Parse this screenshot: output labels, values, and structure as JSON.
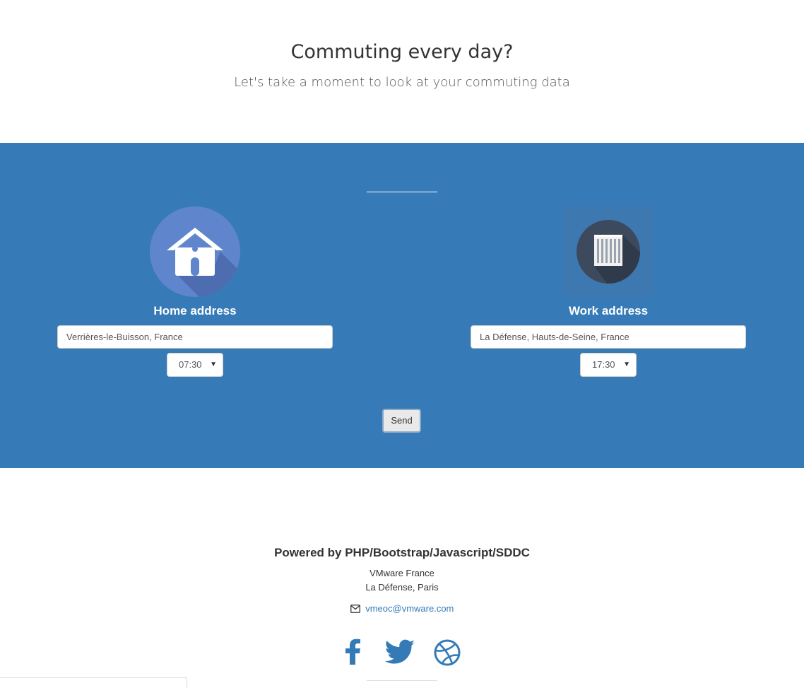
{
  "hero": {
    "title": "Commuting every day?",
    "subtitle": "Let's take a moment to look at your commuting data"
  },
  "form": {
    "home": {
      "icon": "house-icon",
      "label": "Home address",
      "address_value": "Verrières-le-Buisson, France",
      "time_value": "07:30"
    },
    "work": {
      "icon": "office-building-icon",
      "label": "Work address",
      "address_value": "La Défense, Hauts-de-Seine, France",
      "time_value": "17:30"
    },
    "send_label": "Send"
  },
  "footer": {
    "powered_by": "Powered by PHP/Bootstrap/Javascript/SDDC",
    "company": "VMware France",
    "location": "La Défense, Paris",
    "email": "vmeoc@vmware.com",
    "social": [
      "facebook-icon",
      "twitter-icon",
      "dribbble-icon"
    ]
  },
  "colors": {
    "band": "#367bb7",
    "home_icon_bg": "#5f85cc",
    "work_icon_bg": "#3d4a5e",
    "link": "#337ab7"
  }
}
